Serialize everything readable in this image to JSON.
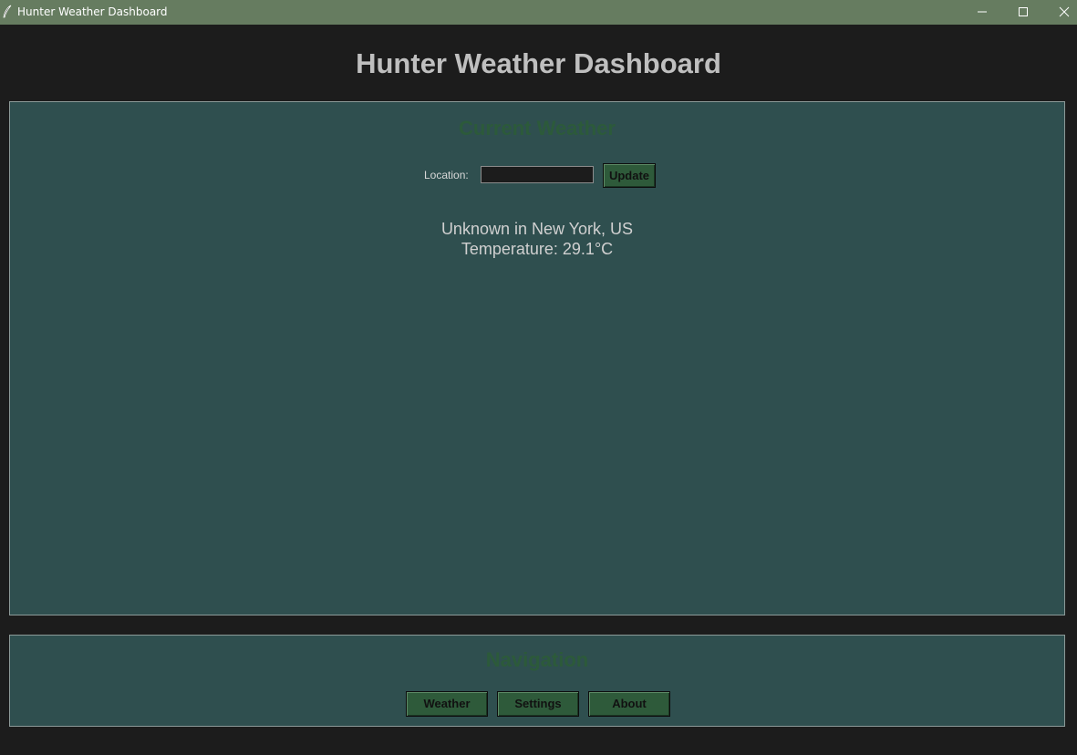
{
  "window": {
    "title": "Hunter Weather Dashboard",
    "titlebar_color": "#667c60"
  },
  "header": {
    "title": "Hunter Weather Dashboard"
  },
  "weather_panel": {
    "title": "Current Weather",
    "location_label": "Location:",
    "location_value": "",
    "update_label": "Update",
    "description": "Unknown in New York, US",
    "temperature": "Temperature: 29.1°C"
  },
  "navigation_panel": {
    "title": "Navigation",
    "buttons": [
      {
        "label": "Weather"
      },
      {
        "label": "Settings"
      },
      {
        "label": "About"
      }
    ]
  },
  "colors": {
    "background": "#1c1c1c",
    "panel": "#2f4f4f",
    "accent_green": "#2e5a3a",
    "heading_green": "#2c5a3a"
  },
  "icons": {
    "app": "feather-icon",
    "minimize": "minimize-icon",
    "maximize": "maximize-icon",
    "close": "close-icon"
  }
}
